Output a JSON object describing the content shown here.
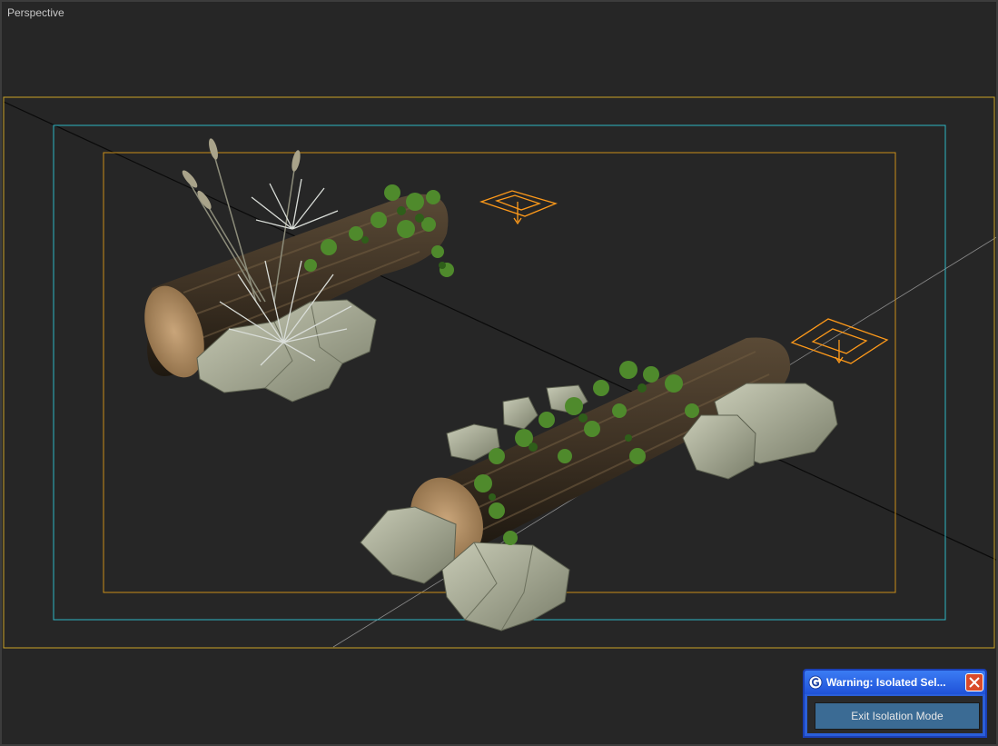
{
  "viewport": {
    "label": "Perspective",
    "colors": {
      "background": "#262626",
      "safe_frame_outer": "#c9a227",
      "safe_frame_action": "#2fb6c4",
      "safe_frame_title": "#c98f1a",
      "light_gizmo": "#ff9a1a"
    }
  },
  "scene_objects": [
    "log-with-cattails-grass-ivy",
    "log-with-ivy-and-rocks",
    "light-gizmo-1",
    "light-gizmo-2"
  ],
  "dialog": {
    "title": "Warning: Isolated Sel...",
    "exit_button_label": "Exit Isolation Mode",
    "icons": {
      "app": "app-icon",
      "close": "close-icon"
    },
    "colors": {
      "titlebar": "#2b5fd9",
      "close": "#d94a2a",
      "button": "#3b6b94"
    }
  }
}
